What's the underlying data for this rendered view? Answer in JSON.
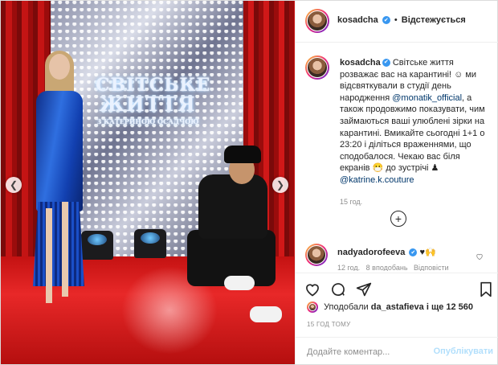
{
  "header": {
    "username": "kosadcha",
    "separator": "•",
    "follow_status": "Відстежується"
  },
  "post": {
    "username": "kosadcha",
    "caption_text": "Світське життя розважає вас на карантині! ☺ ми відсвяткували в студії день народження",
    "mention_1": "@monatik_official",
    "caption_text_2": ", а також продовжимо показувати, чим займаються ваші улюблені зірки на карантині. Вмикайте сьогодні 1+1 о 23:20 і діліться враженнями, що сподобалося. Чекаю вас біля екранів 😷 до зустрічі ♟",
    "mention_2": "@katrine.k.couture",
    "time": "15 год."
  },
  "photo": {
    "sign_line1": "СВІТСЬКЕ",
    "sign_line2": "ЖИТТЯ",
    "sign_line3": "З КАТЕРИНОЮ ОСАДЧОЮ"
  },
  "comment": {
    "username": "nadyadorofeeva",
    "text": "♥🙌",
    "meta_time": "12 год.",
    "meta_likes": "8 вподобань",
    "meta_reply": "Відповісти"
  },
  "likes": {
    "prefix": "Уподобали",
    "user": "da_astafieva",
    "suffix": "і ще 12 560"
  },
  "timestamp": "15 ГОД ТОМУ",
  "add_comment": {
    "placeholder": "Додайте коментар...",
    "publish": "Опублікувати"
  },
  "icons": {
    "verified": "verified-badge-icon",
    "like": "heart-icon",
    "comment": "comment-bubble-icon",
    "share": "paper-plane-icon",
    "save": "bookmark-icon",
    "load_more": "plus-circle-icon",
    "prev": "chevron-left-icon",
    "next": "chevron-right-icon"
  },
  "colors": {
    "verified": "#3897f0",
    "mention": "#00376b",
    "publish_disabled": "#b2dffc"
  }
}
